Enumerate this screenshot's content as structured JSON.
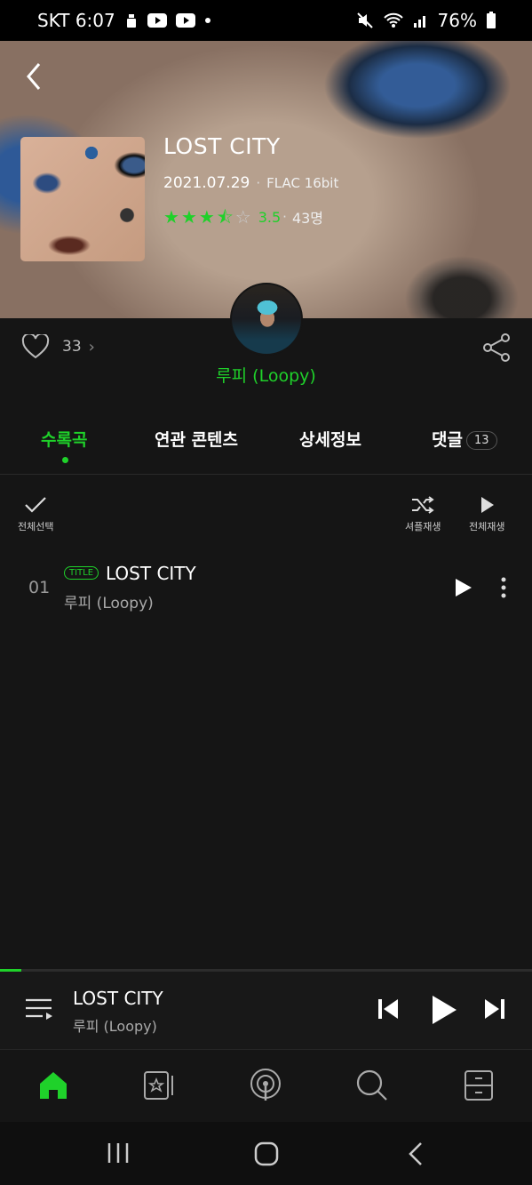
{
  "status_bar": {
    "carrier_time": "SKT 6:07",
    "battery": "76%"
  },
  "album": {
    "title": "LOST CITY",
    "date": "2021.07.29",
    "separator": "·",
    "quality": "FLAC 16bit",
    "stars": [
      "full",
      "full",
      "full",
      "half",
      "empty"
    ],
    "rating": "3.5",
    "rating_count": "43명"
  },
  "social": {
    "like_count": "33",
    "chevron": "›"
  },
  "artist": {
    "name": "루피 (Loopy)"
  },
  "tabs": [
    {
      "label": "수록곡",
      "active": true
    },
    {
      "label": "연관 콘텐츠"
    },
    {
      "label": "상세정보"
    },
    {
      "label": "댓글",
      "badge": "13"
    }
  ],
  "toolbar": {
    "select_all": "전체선택",
    "shuffle_play": "셔플재생",
    "play_all": "전체재생"
  },
  "tracks": [
    {
      "number": "01",
      "badge": "TITLE",
      "title": "LOST CITY",
      "artist": "루피 (Loopy)"
    }
  ],
  "player": {
    "title": "LOST CITY",
    "artist": "루피 (Loopy)",
    "progress": 0.04
  },
  "colors": {
    "accent": "#1fd12a",
    "background": "#151515"
  },
  "icons": {
    "bottom_nav": [
      "home-icon",
      "music-card-icon",
      "podcast-icon",
      "search-icon",
      "library-icon"
    ],
    "system_nav": [
      "recents-icon",
      "home-icon",
      "back-icon"
    ]
  }
}
